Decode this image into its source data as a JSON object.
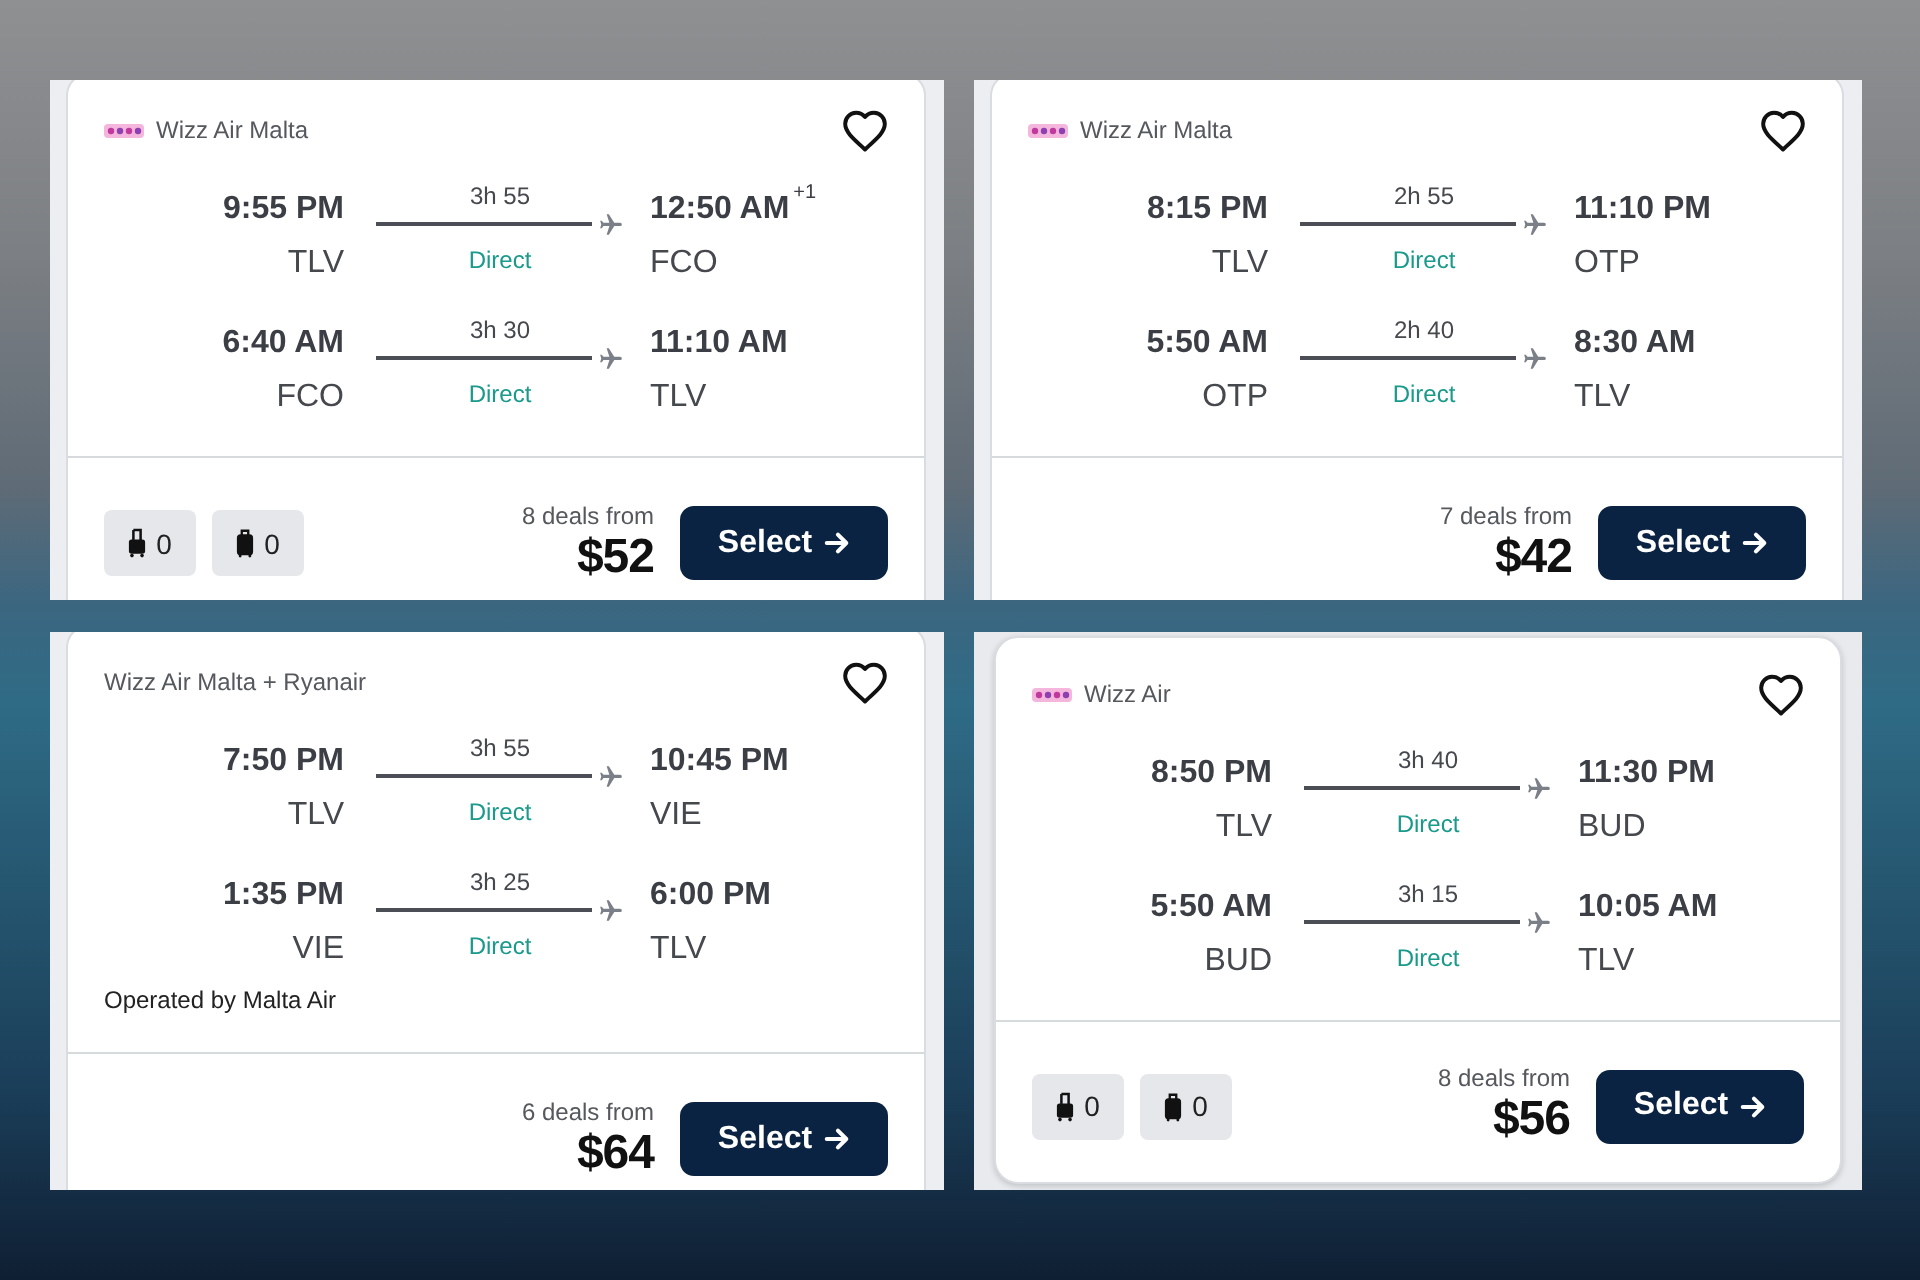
{
  "cards": [
    {
      "airline": "Wizz Air Malta",
      "logo": true,
      "saved": false,
      "legs": [
        {
          "depart_time": "9:55 PM",
          "depart_airport": "TLV",
          "duration": "3h 55",
          "stops": "Direct",
          "arrive_time": "12:50 AM",
          "arrive_day_offset": "+1",
          "arrive_airport": "FCO"
        },
        {
          "depart_time": "6:40 AM",
          "depart_airport": "FCO",
          "duration": "3h 30",
          "stops": "Direct",
          "arrive_time": "11:10 AM",
          "arrive_airport": "TLV"
        }
      ],
      "baggage": [
        {
          "kind": "carry_on",
          "count": "0"
        },
        {
          "kind": "checked",
          "count": "0"
        }
      ],
      "deals": "8 deals from",
      "price": "$52",
      "button": "Select"
    },
    {
      "airline": "Wizz Air Malta",
      "logo": true,
      "saved": false,
      "legs": [
        {
          "depart_time": "8:15 PM",
          "depart_airport": "TLV",
          "duration": "2h 55",
          "stops": "Direct",
          "arrive_time": "11:10 PM",
          "arrive_airport": "OTP"
        },
        {
          "depart_time": "5:50 AM",
          "depart_airport": "OTP",
          "duration": "2h 40",
          "stops": "Direct",
          "arrive_time": "8:30 AM",
          "arrive_airport": "TLV"
        }
      ],
      "deals": "7 deals from",
      "price": "$42",
      "button": "Select"
    },
    {
      "airline": "Wizz Air Malta + Ryanair",
      "logo": false,
      "saved": false,
      "legs": [
        {
          "depart_time": "7:50 PM",
          "depart_airport": "TLV",
          "duration": "3h 55",
          "stops": "Direct",
          "arrive_time": "10:45 PM",
          "arrive_airport": "VIE"
        },
        {
          "depart_time": "1:35 PM",
          "depart_airport": "VIE",
          "duration": "3h 25",
          "stops": "Direct",
          "arrive_time": "6:00 PM",
          "arrive_airport": "TLV"
        }
      ],
      "operated_by": "Operated by Malta Air",
      "deals": "6 deals from",
      "price": "$64",
      "button": "Select"
    },
    {
      "airline": "Wizz Air",
      "logo": true,
      "saved": false,
      "legs": [
        {
          "depart_time": "8:50 PM",
          "depart_airport": "TLV",
          "duration": "3h 40",
          "stops": "Direct",
          "arrive_time": "11:30 PM",
          "arrive_airport": "BUD"
        },
        {
          "depart_time": "5:50 AM",
          "depart_airport": "BUD",
          "duration": "3h 15",
          "stops": "Direct",
          "arrive_time": "10:05 AM",
          "arrive_airport": "TLV"
        }
      ],
      "baggage": [
        {
          "kind": "carry_on",
          "count": "0"
        },
        {
          "kind": "checked",
          "count": "0"
        }
      ],
      "deals": "8 deals from",
      "price": "$56",
      "button": "Select"
    }
  ]
}
